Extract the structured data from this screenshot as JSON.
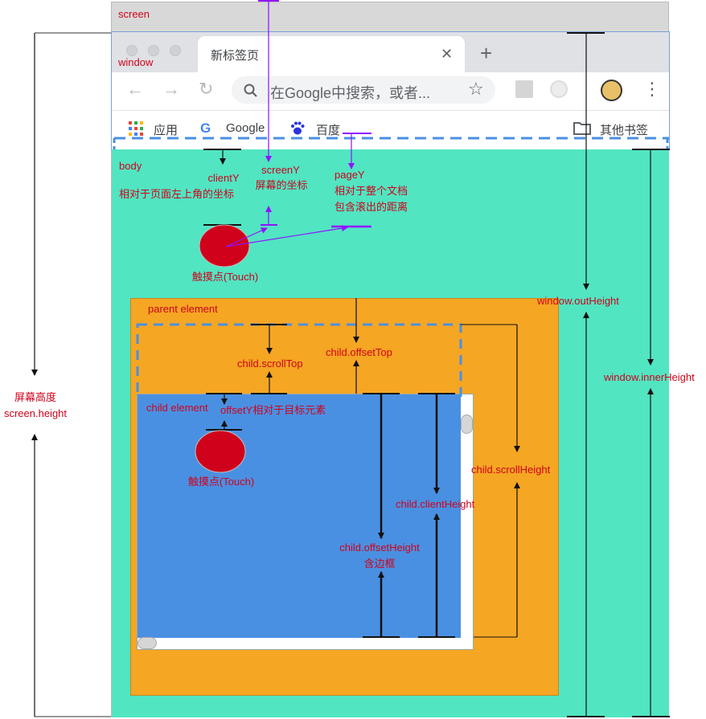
{
  "labels": {
    "screen": "screen",
    "window": "window",
    "body": "body",
    "clientY": "clientY",
    "clientY_desc": "相对于页面左上角的坐标",
    "screenY": "screenY",
    "screenY_desc": "屏幕的坐标",
    "pageY": "pageY",
    "pageY_desc1": "相对于整个文档",
    "pageY_desc2": "包含滚出的距离",
    "touch_top": "触摸点(Touch)",
    "parent_element": "parent element",
    "child_element": "child element",
    "offsetY": "offsetY相对于目标元素",
    "touch_child": "触摸点(Touch)",
    "child_scrollTop": "child.scrollTop",
    "child_offsetTop": "child.offsetTop",
    "child_clientHeight": "child.clientHeight",
    "child_offsetHeight": "child.offsetHeight",
    "child_offsetHeight_note": "含边框",
    "child_scrollHeight": "child.scrollHeight",
    "window_outHeight": "window.outHeight",
    "window_innerHeight": "window.innerHeight",
    "screen_height_cn": "屏幕高度",
    "screen_height": "screen.height"
  },
  "browser": {
    "tab_title": "新标签页",
    "tab_close": "✕",
    "new_tab": "+",
    "omnibox_placeholder": "在Google中搜索，或者...",
    "back_icon": "←",
    "forward_icon": "→",
    "reload_icon": "↻",
    "star_icon": "☆",
    "menu_icon": "⋮",
    "bookmarks": {
      "apps": "应用",
      "google": "Google",
      "baidu": "百度",
      "other": "其他书签"
    }
  },
  "colors": {
    "annotation_text": "#d0021b",
    "purple": "#9013fe",
    "body": "#51e5c2",
    "parent": "#f5a623",
    "child": "#4a90e2",
    "touch": "#d0021b",
    "dashed": "#4a90e2"
  }
}
